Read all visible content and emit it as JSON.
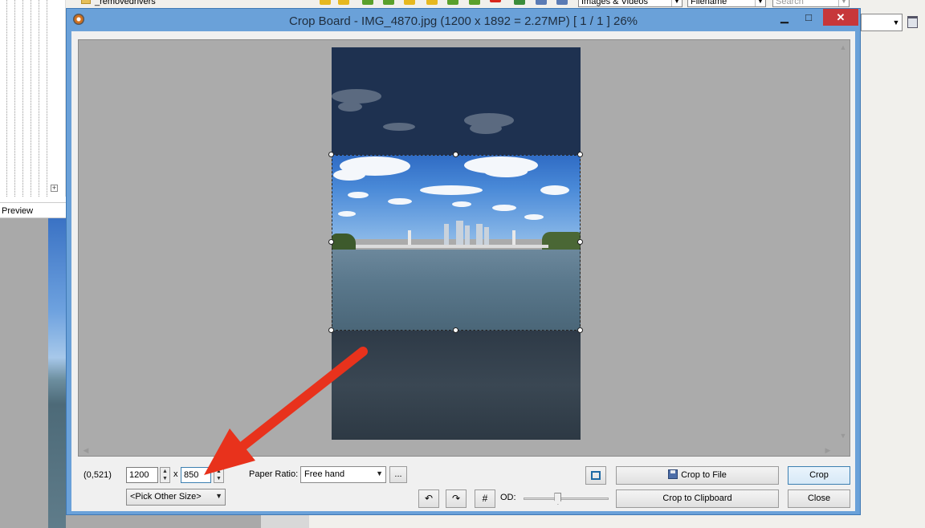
{
  "background": {
    "folder_item": "_removedrivers",
    "toolbar_combo_1": "Images & Videos",
    "toolbar_combo_2": "Filename",
    "search_placeholder": "Search",
    "tree_expander": "+",
    "preview_label": "Preview"
  },
  "dialog": {
    "title": "Crop Board  -  IMG_4870.jpg  (1200 x 1892 = 2.27MP)  [ 1 / 1 ]   26%",
    "minimize_glyph": "▁",
    "maximize_glyph": "□",
    "close_glyph": "✕"
  },
  "controls": {
    "coords": "(0,521)",
    "width_value": "1200",
    "times": "x",
    "height_value": "850",
    "paper_ratio_label": "Paper Ratio:",
    "paper_ratio_value": "Free hand",
    "more_button": "...",
    "pick_size_value": "<Pick Other Size>",
    "rotate_left_glyph": "↶",
    "rotate_right_glyph": "↷",
    "grid_glyph": "#",
    "od_label": "OD:",
    "crop_to_file_label": "Crop to File",
    "crop_button": "Crop",
    "crop_to_clipboard_label": "Crop to Clipboard",
    "close_button": "Close",
    "spin_up": "▲",
    "spin_down": "▼",
    "dropdown_glyph": "▼"
  },
  "scroll_glyphs": {
    "up": "▲",
    "down": "▼",
    "left": "◀",
    "right": "▶"
  },
  "colors": {
    "title_bar": "#6aa1d9",
    "close_button": "#c7373a",
    "annotation_arrow": "#e8321c"
  }
}
